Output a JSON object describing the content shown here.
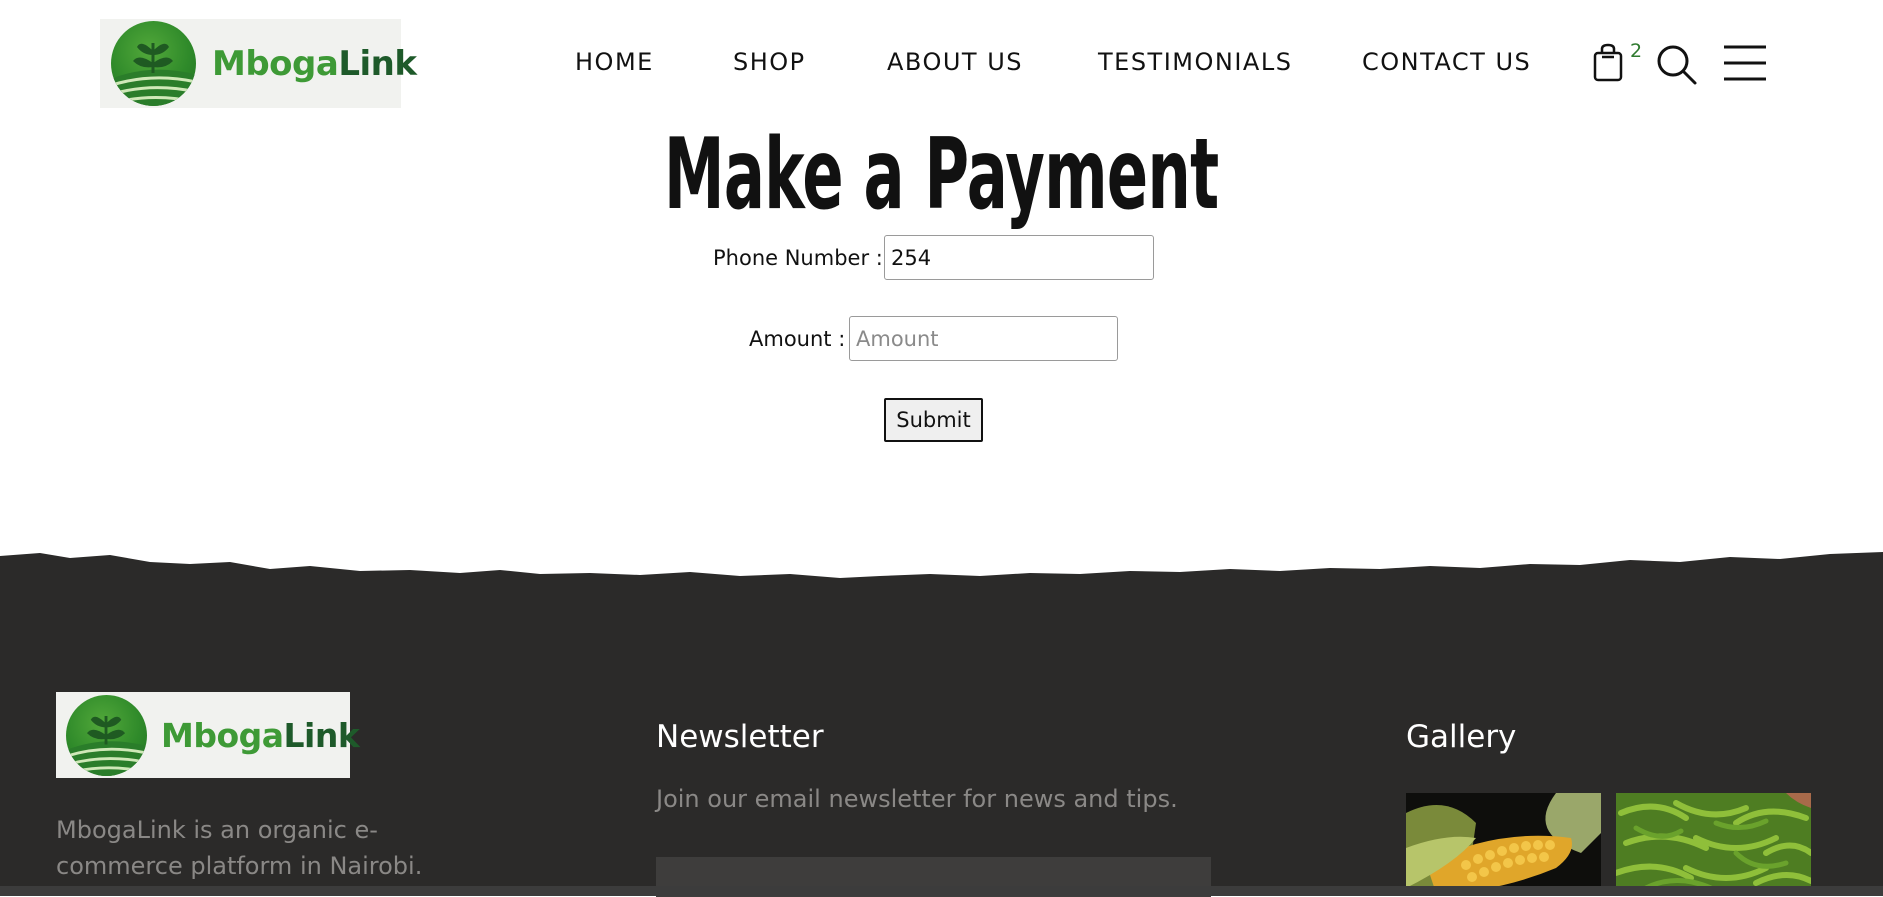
{
  "brand": {
    "name_part1": "Mboga",
    "name_part2": "Link",
    "logo_icon": "sprout-field-logo"
  },
  "nav": {
    "items": [
      {
        "label": "HOME"
      },
      {
        "label": "SHOP"
      },
      {
        "label": "ABOUT US"
      },
      {
        "label": "TESTIMONIALS"
      },
      {
        "label": "CONTACT US"
      }
    ],
    "cart_count": "2",
    "icons": [
      "shopping-bag-icon",
      "search-icon",
      "hamburger-menu-icon"
    ]
  },
  "payment": {
    "title": "Make a Payment",
    "phone_label": "Phone Number :",
    "phone_value": "254",
    "amount_label": "Amount :",
    "amount_placeholder": "Amount",
    "submit_label": "Submit"
  },
  "footer": {
    "about_text": "MbogaLink is an organic e-commerce platform in Nairobi.",
    "newsletter_heading": "Newsletter",
    "newsletter_text": "Join our email newsletter for news and tips.",
    "gallery_heading": "Gallery",
    "gallery_images": [
      "corn-cob-image",
      "green-beans-image"
    ]
  },
  "colors": {
    "brand_light_green": "#3e9a36",
    "brand_dark_green": "#1e5a2a",
    "footer_bg": "#2b2a29",
    "footer_text": "#8a8886",
    "cart_badge": "#2f7a2f"
  }
}
